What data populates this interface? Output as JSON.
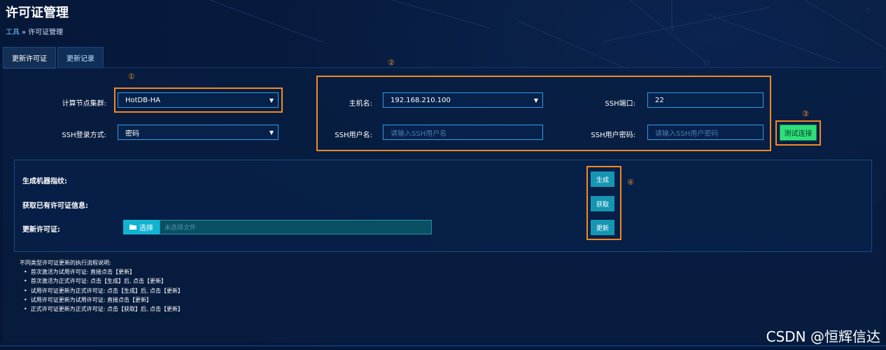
{
  "page": {
    "title": "许可证管理"
  },
  "breadcrumb": {
    "root": "工具",
    "separator": "»",
    "current": "许可证管理"
  },
  "tabs": [
    {
      "label": "更新许可证",
      "active": true
    },
    {
      "label": "更新记录",
      "active": false
    }
  ],
  "form": {
    "cluster_label": "计算节点集群:",
    "cluster_value": "HotDB-HA",
    "login_method_label": "SSH登录方式:",
    "login_method_value": "密码",
    "host_label": "主机名:",
    "host_value": "192.168.210.100",
    "ssh_port_label": "SSH端口:",
    "ssh_port_value": "22",
    "ssh_user_label": "SSH用户名:",
    "ssh_user_placeholder": "请输入SSH用户名",
    "ssh_password_label": "SSH用户密码:",
    "ssh_password_placeholder": "请输入SSH用户密码",
    "test_button": "测试连接"
  },
  "markers": {
    "m1": "①",
    "m2": "②",
    "m3": "③",
    "m4": "④"
  },
  "actions": {
    "fingerprint_label": "生成机器指纹:",
    "existing_label": "获取已有许可证信息:",
    "update_label": "更新许可证:",
    "generate_button": "生成",
    "fetch_button": "获取",
    "update_button": "更新",
    "file_button": "选择",
    "file_placeholder": "未选择文件"
  },
  "notes": {
    "title": "不同类型许可证更新的执行流程说明:",
    "items": [
      "首次激活为试用许可证: 直接点击【更新】",
      "首次激活为正式许可证: 点击【生成】后, 点击【更新】",
      "试用许可证更新为正式许可证: 点击【生成】后, 点击【更新】",
      "试用许可证更新为试用许可证: 直接点击【更新】",
      "正式许可证更新为正式许可证: 点击【获取】后, 点击【更新】"
    ]
  },
  "watermark": "CSDN @恒辉信达",
  "colors": {
    "accent": "#2c9ee6",
    "highlight": "#f08a24",
    "success": "#2fe07a",
    "teal": "#1597b3"
  }
}
